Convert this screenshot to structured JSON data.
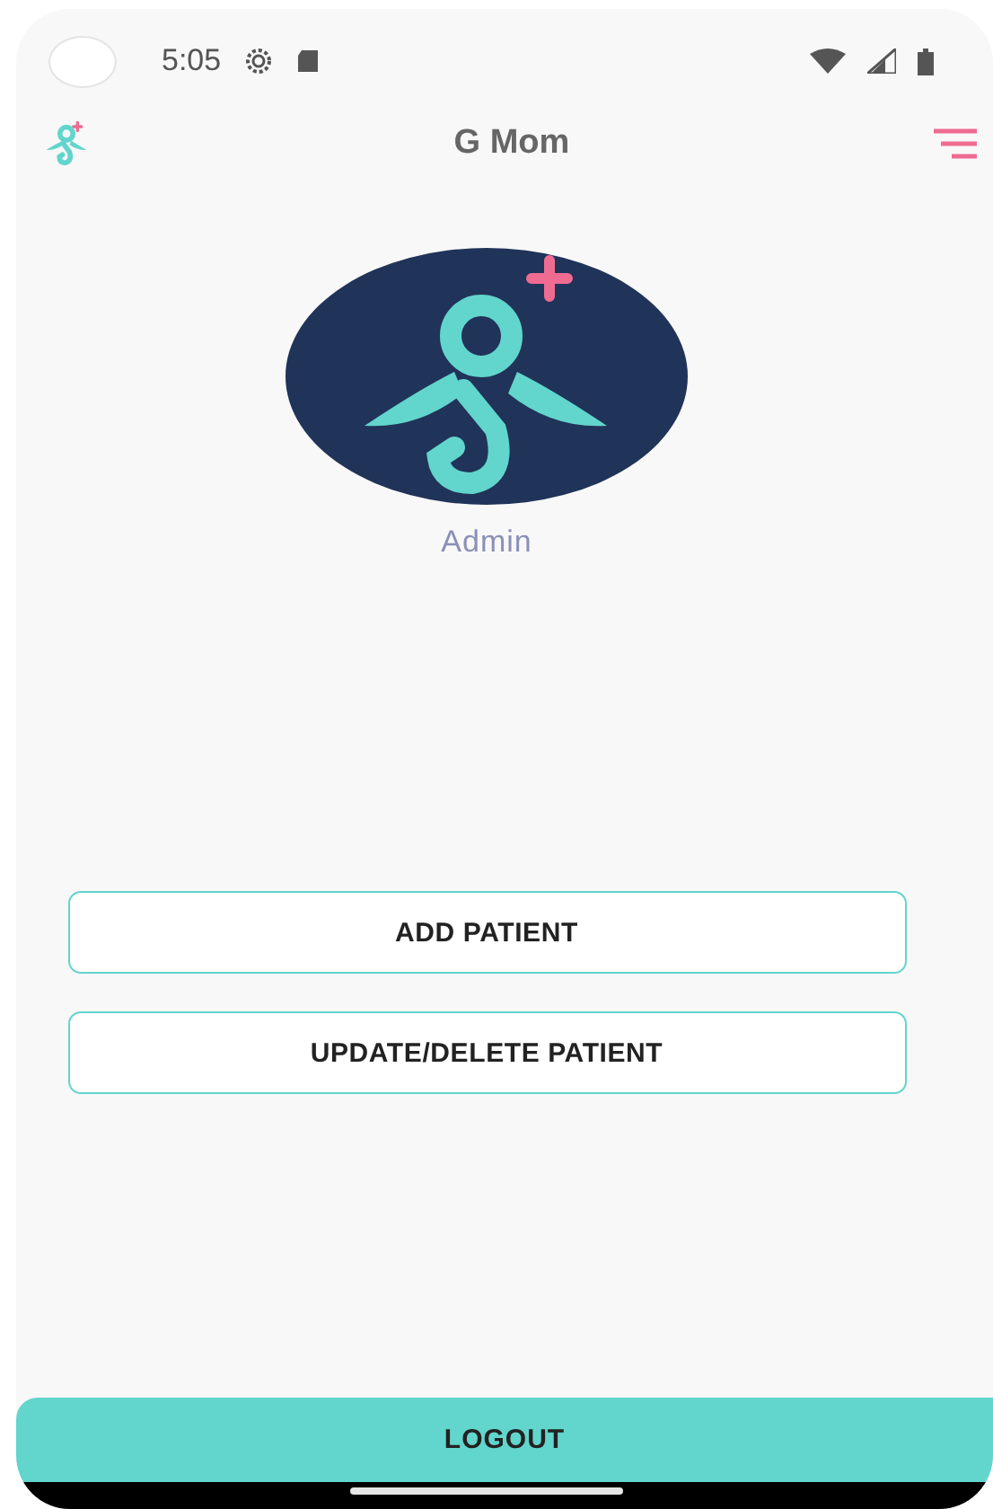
{
  "status_bar": {
    "time": "5:05"
  },
  "app_bar": {
    "title": "G Mom"
  },
  "profile": {
    "name": "Admin"
  },
  "actions": [
    {
      "label": "ADD PATIENT"
    },
    {
      "label": "UPDATE/DELETE PATIENT"
    }
  ],
  "logout": {
    "label": "LOGOUT"
  }
}
